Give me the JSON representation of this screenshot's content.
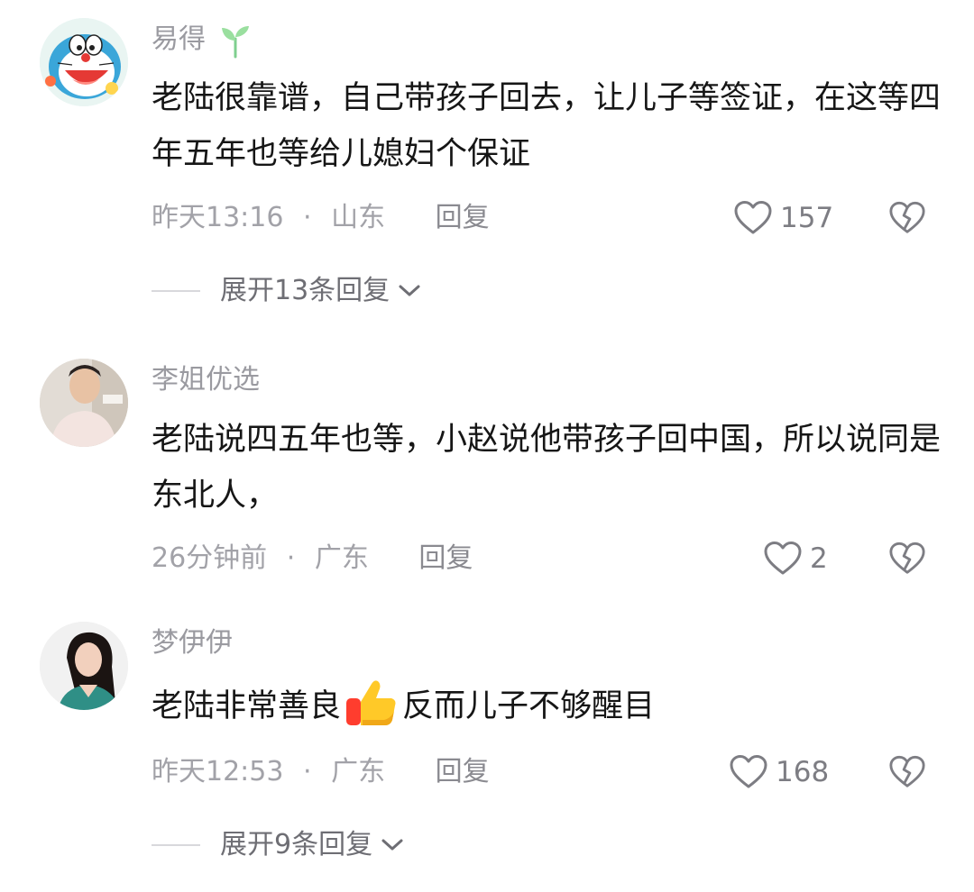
{
  "comments": [
    {
      "username": "易得",
      "content": "老陆很靠谱，自己带孩子回去，让儿子等签证，在这等四年五年也等给儿媳妇个保证",
      "time": "昨天13:16",
      "location": "山东",
      "reply_label": "回复",
      "likes": "157",
      "expand_label": "展开13条回复"
    },
    {
      "username": "李姐优选",
      "content": "老陆说四五年也等，小赵说他带孩子回中国，所以说同是东北人，",
      "time": "26分钟前",
      "location": "广东",
      "reply_label": "回复",
      "likes": "2"
    },
    {
      "username": "梦伊伊",
      "content_before": "老陆非常善良",
      "content_after": "反而儿子不够醒目",
      "time": "昨天12:53",
      "location": "广东",
      "reply_label": "回复",
      "likes": "168",
      "expand_label": "展开9条回复"
    }
  ],
  "separator": "·",
  "icons": {
    "like": "heart-outline-icon",
    "dislike": "broken-heart-icon",
    "expand": "chevron-down-icon",
    "badge": "sprout-icon",
    "emoji": "thumbs-up-emoji"
  },
  "colors": {
    "text": "#161616",
    "meta": "#a2a2a8",
    "icon": "#7d7d83"
  }
}
